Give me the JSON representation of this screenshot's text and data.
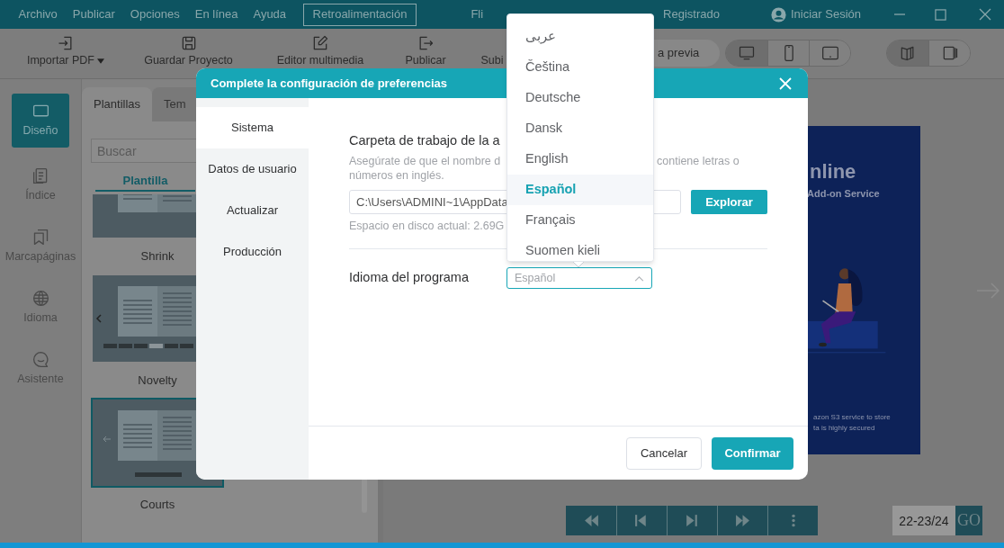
{
  "menu": [
    "Archivo",
    "Publicar",
    "Opciones",
    "En línea",
    "Ayuda"
  ],
  "feedback_button": "Retroalimentación",
  "app_title_start": "Fli",
  "app_title_end": "Registrado",
  "sign_in": "Iniciar Sesión",
  "toolbar": [
    {
      "label": "Importar PDF",
      "kind": "import",
      "caret": true
    },
    {
      "label": "Guardar Proyecto",
      "kind": "save"
    },
    {
      "label": "Editor multimedia",
      "kind": "edit"
    },
    {
      "label": "Publicar",
      "kind": "publish"
    },
    {
      "label": "Subi",
      "kind": "none"
    }
  ],
  "preview_button": "a previa",
  "device_modes": [
    {
      "kind": "desktop",
      "selected": true
    },
    {
      "kind": "phone",
      "selected": false
    },
    {
      "kind": "tablet",
      "selected": false
    }
  ],
  "page_modes": [
    {
      "kind": "book",
      "selected": true
    },
    {
      "kind": "single",
      "selected": false
    }
  ],
  "rail": [
    {
      "label": "Diseño",
      "kind": "monitor",
      "selected": true
    },
    {
      "label": "Índice",
      "kind": "list",
      "selected": false
    },
    {
      "label": "Marcapáginas",
      "kind": "bookmark",
      "selected": false
    },
    {
      "label": "Idioma",
      "kind": "globe",
      "selected": false
    },
    {
      "label": "Asistente",
      "kind": "chat",
      "selected": false
    }
  ],
  "panel": {
    "tabs": [
      {
        "label": "Plantillas",
        "selected": true
      },
      {
        "label": "Tem",
        "selected": false
      }
    ],
    "search": {
      "placeholder": "Buscar"
    },
    "subtab": "Plantilla",
    "templates": [
      {
        "name": "Shrink",
        "kind": "shrink",
        "selected": false
      },
      {
        "name": "Novelty",
        "kind": "novelty",
        "selected": false
      },
      {
        "name": "Courts",
        "kind": "courts",
        "selected": true
      }
    ]
  },
  "book_page": {
    "heading": "nline",
    "subheading": "Add-on Service",
    "caption_1": "azon S3 service to store",
    "caption_2": "ta is highly secured"
  },
  "page_nav": [
    {
      "kind": "first"
    },
    {
      "kind": "prev"
    },
    {
      "kind": "next"
    },
    {
      "kind": "last"
    },
    {
      "kind": "more"
    }
  ],
  "page_field": {
    "value": "22-23/24"
  },
  "go_button": "GO",
  "dialog": {
    "title": "Complete la configuración de preferencias",
    "nav": [
      {
        "label": "Sistema",
        "selected": true
      },
      {
        "label": "Datos de usuario",
        "selected": false
      },
      {
        "label": "Actualizar",
        "selected": false
      },
      {
        "label": "Producción",
        "selected": false
      }
    ],
    "folder": {
      "label": "Carpeta de trabajo de la a",
      "hint_start": "Asegúrate de que el nombre d",
      "hint_end": "contiene letras o",
      "hint_line_2": "números en inglés.",
      "path": "C:\\Users\\ADMINI~1\\AppData",
      "browse": "Explorar",
      "disk": "Espacio en disco actual: 2.69G"
    },
    "language": {
      "label": "Idioma del programa",
      "value": "Español",
      "expanded": true,
      "options": [
        {
          "label": "عربى",
          "selected": false
        },
        {
          "label": "Čeština",
          "selected": false
        },
        {
          "label": "Deutsche",
          "selected": false
        },
        {
          "label": "Dansk",
          "selected": false
        },
        {
          "label": "English",
          "selected": false
        },
        {
          "label": "Español",
          "selected": true
        },
        {
          "label": "Français",
          "selected": false
        },
        {
          "label": "Suomen kieli",
          "selected": false
        }
      ]
    },
    "buttons": {
      "cancel": "Cancelar",
      "confirm": "Confirmar"
    }
  }
}
